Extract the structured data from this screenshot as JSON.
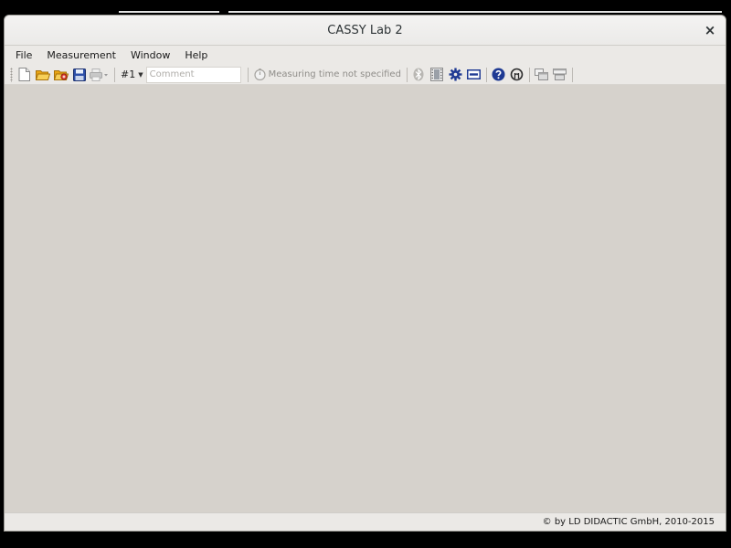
{
  "window": {
    "title": "CASSY Lab 2",
    "close_label": "×"
  },
  "menubar": {
    "items": [
      {
        "label": "File"
      },
      {
        "label": "Measurement"
      },
      {
        "label": "Window"
      },
      {
        "label": "Help"
      }
    ]
  },
  "toolbar": {
    "icons": {
      "new": "new-document-icon",
      "open": "open-folder-icon",
      "open_example": "open-example-icon",
      "save": "save-icon",
      "print": "print-icon",
      "timer": "stopwatch-icon",
      "bluetooth": "bluetooth-icon",
      "film": "film-strip-icon",
      "settings": "gear-icon",
      "display": "display-icon",
      "help": "help-icon",
      "update": "update-icon",
      "window_a": "window-layout-icon",
      "window_b": "window-split-icon"
    },
    "measurement_select": "#1",
    "comment_placeholder": "Comment",
    "comment_value": "",
    "measuring_time_text": "Measuring time not specified"
  },
  "statusbar": {
    "copyright": "© by LD DIDACTIC GmbH, 2010-2015"
  },
  "colors": {
    "workspace": "#d6d2cc",
    "chrome": "#ebe9e6",
    "accent_blue": "#1f3a93",
    "folder_yellow": "#f0b62b"
  }
}
